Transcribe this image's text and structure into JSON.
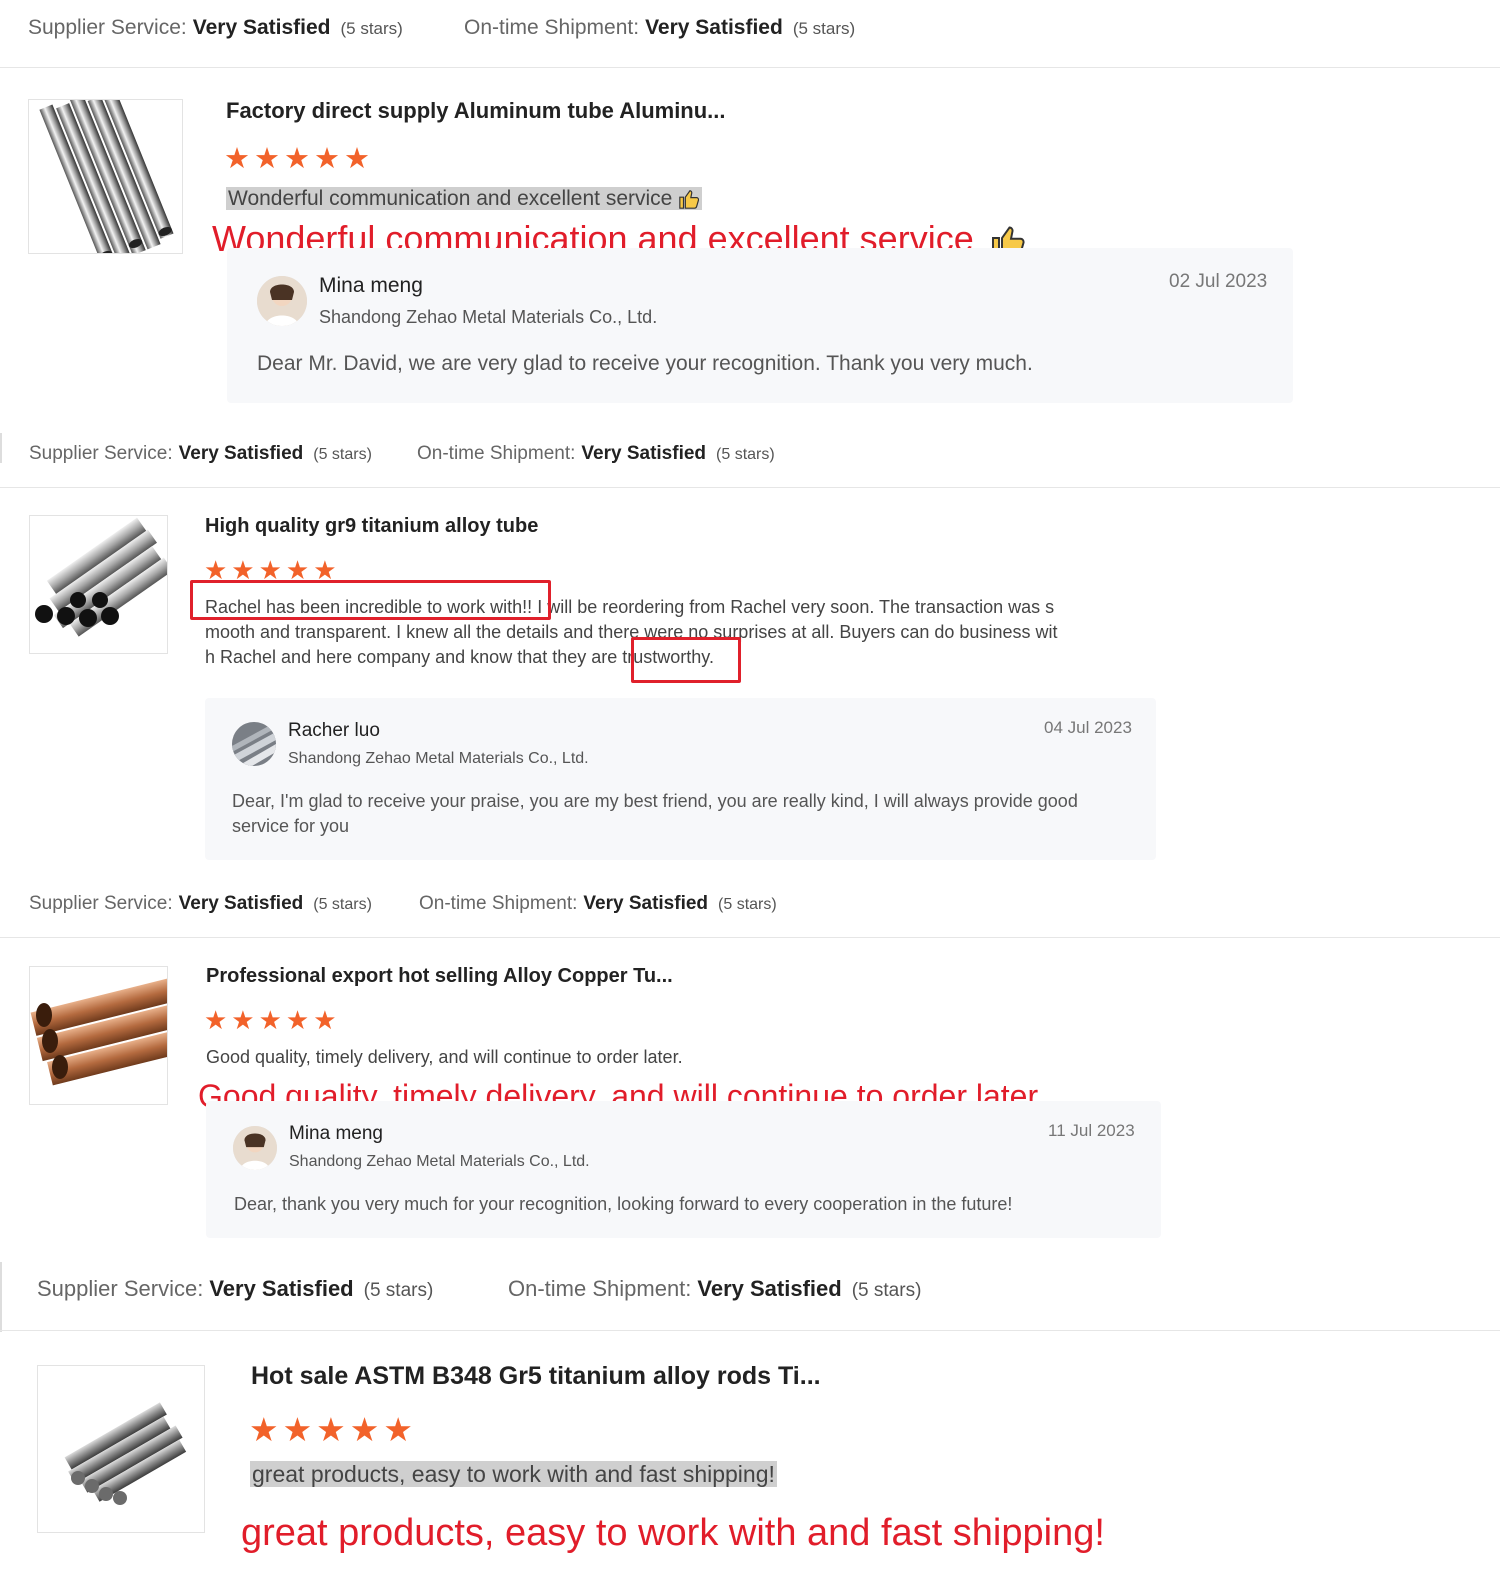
{
  "labels": {
    "supplier_service": "Supplier Service:",
    "ontime_shipment": "On-time Shipment:",
    "rating_value": "Very Satisfied",
    "stars_text": "(5 stars)",
    "star_glyphs": "★★★★★"
  },
  "reviews": [
    {
      "product": "Factory direct supply Aluminum tube Aluminu...",
      "rating": 5,
      "text": "Wonderful communication and excellent service",
      "overlay": "Wonderful communication and excellent service",
      "reply": {
        "name": "Mina meng",
        "company": "Shandong Zehao Metal Materials Co., Ltd.",
        "date": "02 Jul 2023",
        "text": "Dear Mr. David, we are very glad to receive your recognition. Thank you very much."
      }
    },
    {
      "product": "High quality gr9 titanium alloy tube",
      "rating": 5,
      "text_line1_boxed": "Rachel has been incredible to work with!!",
      "text_line1_rest": "I will be reordering from Rachel very soon. The transaction was s",
      "text_line2": "mooth and transparent. I knew all the details and there were no surprises at all. Buyers can do business wit",
      "text_line3_pre": "h Rachel and here company and know that they are",
      "text_line3_boxed": "trustworthy.",
      "reply": {
        "name": "Racher luo",
        "company": "Shandong Zehao Metal Materials Co., Ltd.",
        "date": "04 Jul 2023",
        "text": "Dear, I'm glad to receive your praise, you are my best friend, you are really kind, I will always provide good service for you"
      }
    },
    {
      "product": "Professional export hot selling Alloy Copper Tu...",
      "rating": 5,
      "text": "Good quality, timely delivery, and will continue to order later.",
      "overlay": "Good quality, timely delivery, and will continue to order later.",
      "reply": {
        "name": "Mina meng",
        "company": "Shandong Zehao Metal Materials Co., Ltd.",
        "date": "11 Jul 2023",
        "text": "Dear, thank you very much for your recognition, looking forward to every cooperation in the future!"
      }
    },
    {
      "product": "Hot sale ASTM B348 Gr5 titanium alloy rods Ti...",
      "rating": 5,
      "text": "great products, easy to work with and fast shipping!",
      "overlay": "great products, easy to work with and fast shipping!"
    }
  ],
  "colors": {
    "star": "#f2622a",
    "overlay_red": "#e11d2a",
    "highlight_gray": "#cfcfcf",
    "reply_bg": "#f7f8fa"
  },
  "icons": [
    "thumbs-up-icon",
    "star-icon"
  ]
}
